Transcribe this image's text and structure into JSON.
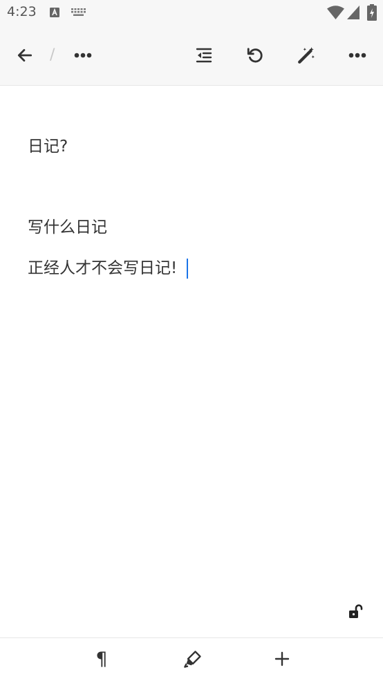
{
  "status_bar": {
    "time": "4:23",
    "icons": [
      "font-a-icon",
      "keyboard-icon",
      "wifi-icon",
      "cell-signal-icon",
      "battery-charging-icon"
    ]
  },
  "toolbar": {
    "separator": "/",
    "icons": [
      "back-arrow-icon",
      "more-horizontal-icon",
      "outdent-icon",
      "undo-icon",
      "magic-wand-icon",
      "more-horizontal-icon"
    ]
  },
  "document": {
    "paragraphs": [
      "日记?",
      "写什么日记",
      "正经人才不会写日记!"
    ]
  },
  "lock": {
    "icon": "unlocked-icon"
  },
  "bottom_bar": {
    "paragraph_symbol": "¶",
    "icons": [
      "paragraph-icon",
      "highlighter-icon",
      "plus-icon"
    ]
  },
  "colors": {
    "bar_background": "#f7f7f7",
    "text": "#333333",
    "caret": "#1a73e8",
    "separator": "#c8c8c8"
  }
}
